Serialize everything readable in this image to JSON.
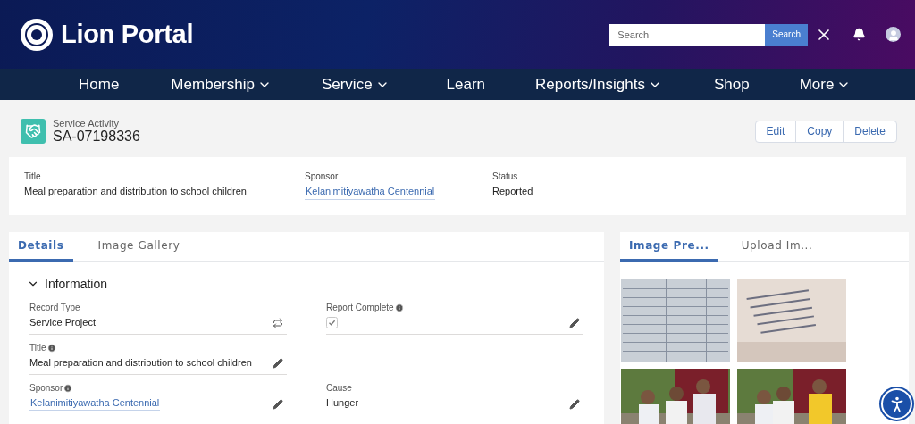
{
  "header": {
    "logo_text": "Lion Portal",
    "search": {
      "placeholder": "Search"
    },
    "search_button": "Search"
  },
  "nav": [
    {
      "label": "Home",
      "dropdown": false
    },
    {
      "label": "Membership",
      "dropdown": true
    },
    {
      "label": "Service",
      "dropdown": true
    },
    {
      "label": "Learn",
      "dropdown": false
    },
    {
      "label": "Reports/Insights",
      "dropdown": true
    },
    {
      "label": "Shop",
      "dropdown": false
    },
    {
      "label": "More",
      "dropdown": true
    }
  ],
  "record": {
    "type": "Service Activity",
    "name": "SA-07198336",
    "actions": [
      "Edit",
      "Copy",
      "Delete"
    ]
  },
  "highlights": [
    {
      "label": "Title",
      "value": "Meal preparation and distribution to school children",
      "kind": "text"
    },
    {
      "label": "Sponsor",
      "value": "Kelanimitiyawatha Centennial",
      "kind": "link"
    },
    {
      "label": "Status",
      "value": "Reported",
      "kind": "text"
    }
  ],
  "detail_tabs": [
    {
      "label": "Details",
      "selected": true
    },
    {
      "label": "Image Gallery",
      "selected": false
    }
  ],
  "section": {
    "title": "Information",
    "expanded": true
  },
  "fields": [
    {
      "label": "Record Type",
      "kind": "record_type",
      "value": "Service Project",
      "info": false,
      "editable": false
    },
    {
      "label": "Report Complete",
      "kind": "checkbox",
      "checked": true,
      "info": true,
      "editable": true
    },
    {
      "label": "Title",
      "kind": "text",
      "value": "Meal preparation and distribution to school children",
      "info": true,
      "editable": true
    },
    {
      "kind": "blank"
    },
    {
      "label": "Sponsor",
      "kind": "link",
      "value": "Kelanimitiyawatha Centennial",
      "info": true,
      "editable": true
    },
    {
      "label": "Cause",
      "kind": "text",
      "value": "Hunger",
      "info": false,
      "editable": true
    }
  ],
  "image_tabs": [
    {
      "label": "Image Pre...",
      "selected": true
    },
    {
      "label": "Upload Im...",
      "selected": false
    }
  ]
}
